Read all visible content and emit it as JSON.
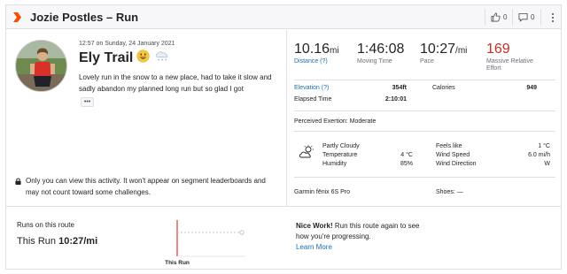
{
  "header": {
    "title": "Jozie Postles – Run",
    "kudos_count": "0",
    "comments_count": "0",
    "brand_color": "#fc4c02"
  },
  "activity": {
    "datetime": "12:57 on Sunday, 24 January 2021",
    "name": "Ely Trail",
    "name_emojis": "😀🌨️",
    "description": "Lovely run in the snow to a new place, had to take it slow and sadly abandon my planned long run but so glad I got",
    "more_label": "•••"
  },
  "privacy": {
    "text": "Only you can view this activity. It won't appear on segment leaderboards and may not count toward some challenges."
  },
  "stats": {
    "distance": {
      "value": "10.16",
      "unit": "mi",
      "label": "Distance (?)"
    },
    "moving_time": {
      "value": "1:46:08",
      "label": "Moving Time"
    },
    "pace": {
      "value": "10:27",
      "unit": "/mi",
      "label": "Pace"
    },
    "relative_effort": {
      "value": "169",
      "label_line1": "Massive Relative",
      "label_line2": "Effort"
    }
  },
  "details": {
    "elevation_label": "Elevation (?)",
    "elevation_value": "354ft",
    "calories_label": "Calories",
    "calories_value": "949",
    "elapsed_label": "Elapsed Time",
    "elapsed_value": "2:10:01",
    "exertion": "Perceived Exertion: Moderate"
  },
  "weather": {
    "condition": "Partly Cloudy",
    "temperature_label": "Temperature",
    "temperature_value": "4 °C",
    "humidity_label": "Humidity",
    "humidity_value": "85%",
    "feels_like_label": "Feels like",
    "feels_like_value": "1 °C",
    "wind_speed_label": "Wind Speed",
    "wind_speed_value": "6.0 mi/h",
    "wind_dir_label": "Wind Direction",
    "wind_dir_value": "W"
  },
  "gear": {
    "device": "Garmin fēnix 6S Pro",
    "shoes": "Shoes: —"
  },
  "route": {
    "runs_label": "Runs on this route",
    "this_run_prefix": "This Run",
    "this_run_pace": "10:27/mi",
    "chart_label": "This Run",
    "nice_bold": "Nice Work!",
    "nice_text": " Run this route again to see how you're progressing.",
    "learn_more": "Learn More"
  }
}
